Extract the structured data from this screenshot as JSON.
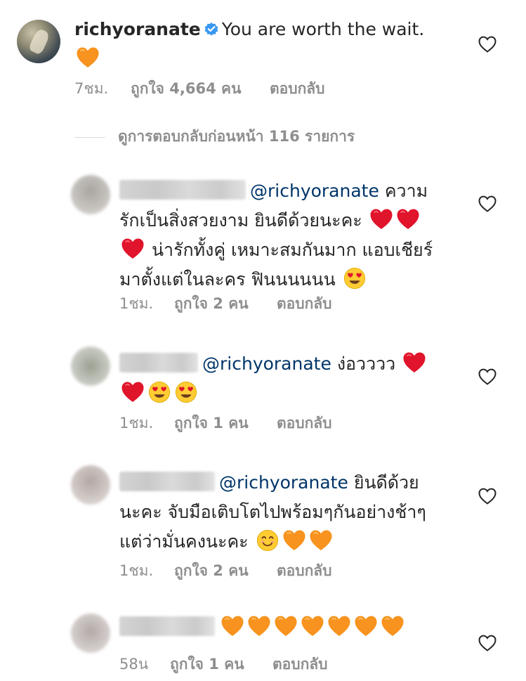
{
  "main_comment": {
    "username": "richyoranate",
    "text": "You are worth the wait.",
    "emojis": [
      "orange-heart-emoji"
    ],
    "time": "7ชม.",
    "likes": "ถูกใจ 4,664 คน",
    "reply": "ตอบกลับ",
    "verified_icon": "verified-badge-icon",
    "verified_color": "#3897f0"
  },
  "view_replies": {
    "label": "ดูการตอบกลับก่อนหน้า 116 รายการ"
  },
  "replies": [
    {
      "mention": "@richyoranate",
      "text_parts": [
        "ความ",
        "รักเป็นสิ่งสวยงาม ยินดีด้วยนะคะ",
        "น่ารักทั้งคู่ เหมาะสมกันมาก แอบเชียร์",
        "มาตั้งแต่ในละคร ฟินนนนนน"
      ],
      "emojis": [
        "red-heart-emoji",
        "red-heart-emoji",
        "red-heart-emoji",
        "heart-eyes-emoji"
      ],
      "time": "1ชม.",
      "likes": "ถูกใจ 2 คน",
      "reply": "ตอบกลับ"
    },
    {
      "mention": "@richyoranate",
      "text_parts": [
        "ง่อวววว"
      ],
      "emojis": [
        "red-heart-emoji",
        "red-heart-emoji",
        "heart-eyes-emoji",
        "heart-eyes-emoji"
      ],
      "time": "1ชม.",
      "likes": "ถูกใจ 1 คน",
      "reply": "ตอบกลับ"
    },
    {
      "mention": "@richyoranate",
      "text_parts": [
        "ยินดีด้วย",
        "นะคะ จับมือเติบโตไปพร้อมๆกันอย่างช้าๆ",
        "แต่ว่ามั่นคงนะคะ"
      ],
      "emojis": [
        "smiling-face-emoji",
        "orange-heart-emoji",
        "orange-heart-emoji"
      ],
      "time": "1ชม.",
      "likes": "ถูกใจ 2 คน",
      "reply": "ตอบกลับ"
    },
    {
      "mention": "",
      "text_parts": [],
      "emojis": [
        "orange-heart-emoji",
        "orange-heart-emoji",
        "orange-heart-emoji",
        "orange-heart-emoji",
        "orange-heart-emoji",
        "orange-heart-emoji",
        "orange-heart-emoji"
      ],
      "time": "58น",
      "likes": "ถูกใจ 1 คน",
      "reply": "ตอบกลับ"
    }
  ],
  "colors": {
    "text": "#262626",
    "meta": "#8e8e8e",
    "mention": "#003569",
    "red_heart": "#e0142b",
    "orange_heart": "#f7931e"
  }
}
